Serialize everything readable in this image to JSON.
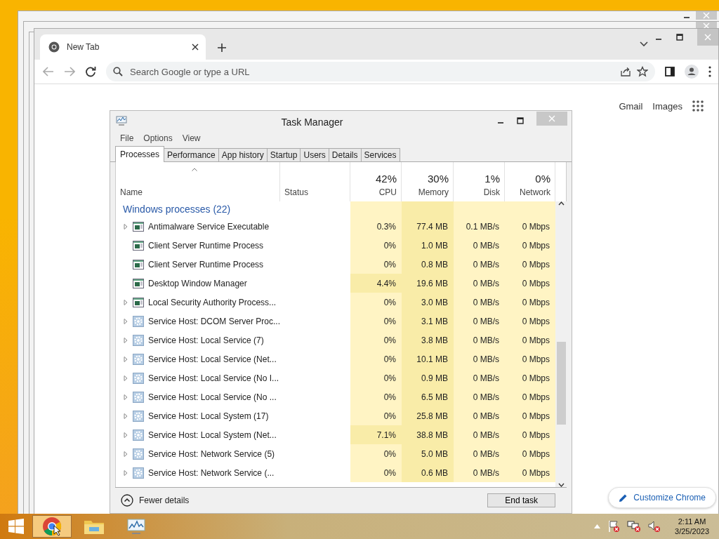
{
  "chrome": {
    "tab_title": "New Tab",
    "address_placeholder": "Search Google or type a URL",
    "links": [
      "Gmail",
      "Images"
    ],
    "customize_button": "Customize Chrome"
  },
  "task_manager": {
    "title": "Task Manager",
    "menu": [
      "File",
      "Options",
      "View"
    ],
    "tabs": [
      {
        "label": "Processes",
        "selected": true
      },
      {
        "label": "Performance",
        "selected": false
      },
      {
        "label": "App history",
        "selected": false
      },
      {
        "label": "Startup",
        "selected": false
      },
      {
        "label": "Users",
        "selected": false
      },
      {
        "label": "Details",
        "selected": false
      },
      {
        "label": "Services",
        "selected": false
      }
    ],
    "columns": [
      {
        "label": "Name"
      },
      {
        "label": "Status"
      },
      {
        "summary": "42%",
        "label": "CPU"
      },
      {
        "summary": "30%",
        "label": "Memory"
      },
      {
        "summary": "1%",
        "label": "Disk"
      },
      {
        "summary": "0%",
        "label": "Network"
      }
    ],
    "group": "Windows processes (22)",
    "rows": [
      {
        "kind": "app",
        "expandable": true,
        "name": "Antimalware Service Executable",
        "cpu": "0.3%",
        "memory": "77.4 MB",
        "disk": "0.1 MB/s",
        "network": "0 Mbps"
      },
      {
        "kind": "app",
        "expandable": false,
        "name": "Client Server Runtime Process",
        "cpu": "0%",
        "memory": "1.0 MB",
        "disk": "0 MB/s",
        "network": "0 Mbps"
      },
      {
        "kind": "app",
        "expandable": false,
        "name": "Client Server Runtime Process",
        "cpu": "0%",
        "memory": "0.8 MB",
        "disk": "0 MB/s",
        "network": "0 Mbps"
      },
      {
        "kind": "app",
        "expandable": false,
        "name": "Desktop Window Manager",
        "cpu": "4.4%",
        "memory": "19.6 MB",
        "disk": "0 MB/s",
        "network": "0 Mbps"
      },
      {
        "kind": "app",
        "expandable": true,
        "name": "Local Security Authority Process...",
        "cpu": "0%",
        "memory": "3.0 MB",
        "disk": "0 MB/s",
        "network": "0 Mbps"
      },
      {
        "kind": "service",
        "expandable": true,
        "name": "Service Host: DCOM Server Proc...",
        "cpu": "0%",
        "memory": "3.1 MB",
        "disk": "0 MB/s",
        "network": "0 Mbps"
      },
      {
        "kind": "service",
        "expandable": true,
        "name": "Service Host: Local Service (7)",
        "cpu": "0%",
        "memory": "3.8 MB",
        "disk": "0 MB/s",
        "network": "0 Mbps"
      },
      {
        "kind": "service",
        "expandable": true,
        "name": "Service Host: Local Service (Net...",
        "cpu": "0%",
        "memory": "10.1 MB",
        "disk": "0 MB/s",
        "network": "0 Mbps"
      },
      {
        "kind": "service",
        "expandable": true,
        "name": "Service Host: Local Service (No I...",
        "cpu": "0%",
        "memory": "0.9 MB",
        "disk": "0 MB/s",
        "network": "0 Mbps"
      },
      {
        "kind": "service",
        "expandable": true,
        "name": "Service Host: Local Service (No ...",
        "cpu": "0%",
        "memory": "6.5 MB",
        "disk": "0 MB/s",
        "network": "0 Mbps"
      },
      {
        "kind": "service",
        "expandable": true,
        "name": "Service Host: Local System (17)",
        "cpu": "0%",
        "memory": "25.8 MB",
        "disk": "0 MB/s",
        "network": "0 Mbps"
      },
      {
        "kind": "service",
        "expandable": true,
        "name": "Service Host: Local System (Net...",
        "cpu": "7.1%",
        "memory": "38.8 MB",
        "disk": "0 MB/s",
        "network": "0 Mbps"
      },
      {
        "kind": "service",
        "expandable": true,
        "name": "Service Host: Network Service (5)",
        "cpu": "0%",
        "memory": "5.0 MB",
        "disk": "0 MB/s",
        "network": "0 Mbps"
      },
      {
        "kind": "service",
        "expandable": true,
        "name": "Service Host: Network Service (...",
        "cpu": "0%",
        "memory": "0.6 MB",
        "disk": "0 MB/s",
        "network": "0 Mbps"
      }
    ],
    "fewer_details": "Fewer details",
    "end_task": "End task"
  },
  "taskbar": {
    "apps": [
      {
        "kind": "chrome",
        "selected": true
      },
      {
        "kind": "explorer",
        "selected": false
      },
      {
        "kind": "task-manager",
        "selected": false
      }
    ],
    "time": "2:11 AM",
    "date": "3/25/2023"
  }
}
